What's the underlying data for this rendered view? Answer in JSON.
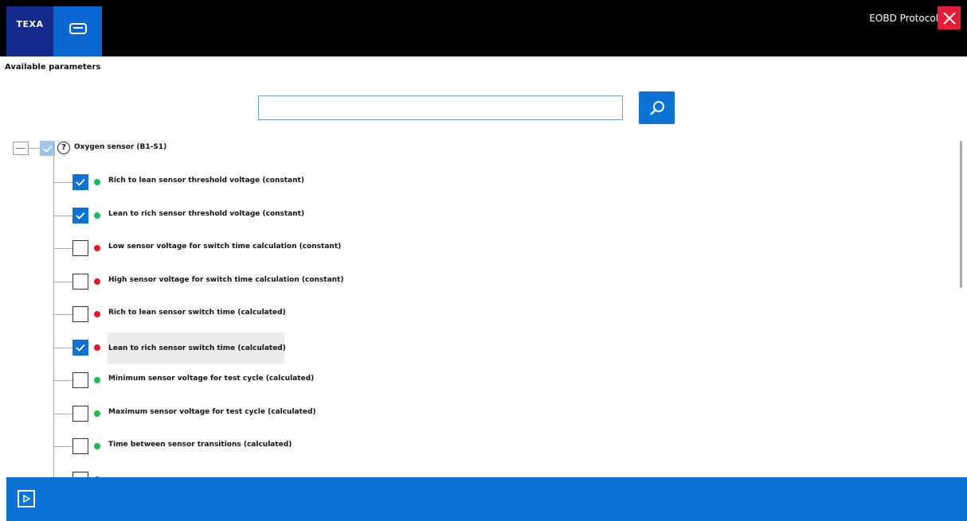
{
  "header": {
    "brand_text": "TEXA",
    "protocol_label": "EOBD Protocol",
    "brand_color": "#142a8c",
    "accent_color": "#0a66d0",
    "close_color": "#e41b3b"
  },
  "section_title": "Available parameters",
  "search": {
    "value": "",
    "placeholder": ""
  },
  "tree": {
    "root": {
      "label": "Oxygen sensor (B1-S1)",
      "checked": "partial",
      "help_icon": "question-icon"
    },
    "items": [
      {
        "label": "Rich to lean sensor threshold voltage (constant)",
        "checked": true,
        "status": "green"
      },
      {
        "label": "Lean to rich sensor threshold voltage (constant)",
        "checked": true,
        "status": "green"
      },
      {
        "label": "Low sensor voltage for switch time calculation (constant)",
        "checked": false,
        "status": "red"
      },
      {
        "label": "High sensor voltage for switch time calculation (constant)",
        "checked": false,
        "status": "red"
      },
      {
        "label": "Rich to lean sensor switch time (calculated)",
        "checked": false,
        "status": "red"
      },
      {
        "label": "Lean to rich sensor switch time (calculated)",
        "checked": true,
        "status": "red",
        "highlighted": true
      },
      {
        "label": "Minimum sensor voltage for test cycle (calculated)",
        "checked": false,
        "status": "green"
      },
      {
        "label": "Maximum sensor voltage for test cycle (calculated)",
        "checked": false,
        "status": "green"
      },
      {
        "label": "Time between sensor transitions (calculated)",
        "checked": false,
        "status": "green"
      },
      {
        "label": "",
        "checked": false,
        "status": "red"
      }
    ]
  },
  "colors": {
    "green": "#1db954",
    "red": "#e0192f",
    "checked": "#0a73d4"
  }
}
